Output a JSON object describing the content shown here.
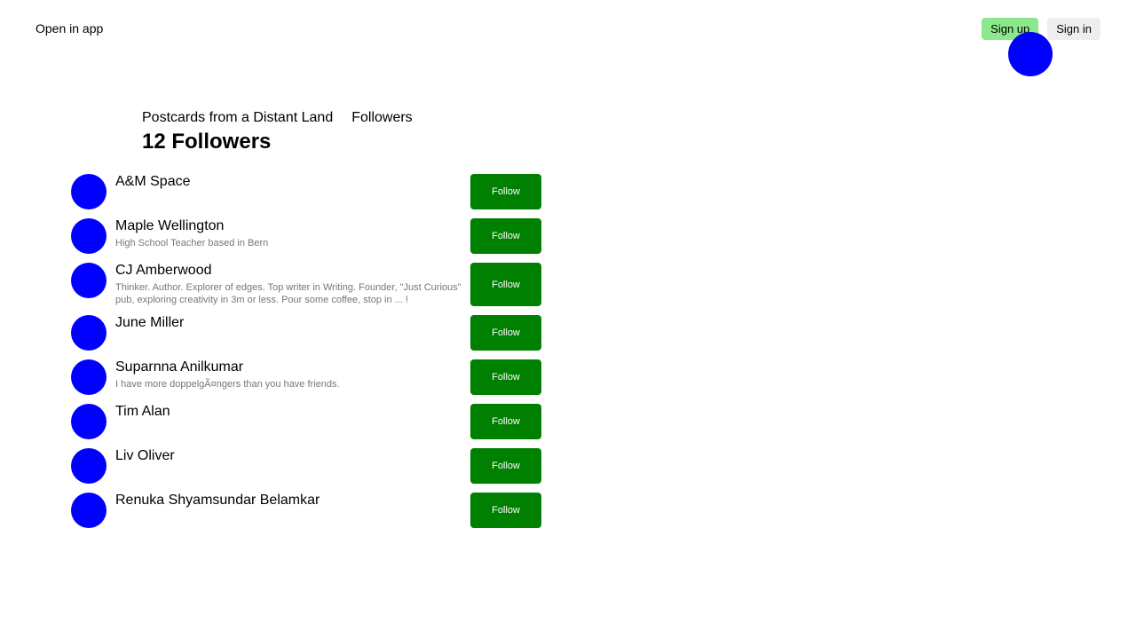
{
  "header": {
    "open_in_app": "Open in app",
    "signup_label": "Sign up",
    "signin_label": "Sign in"
  },
  "breadcrumb": {
    "publication": "Postcards from a Distant Land",
    "section": "Followers"
  },
  "page_title": "12 Followers",
  "followers": [
    {
      "name": "A&M Space",
      "bio": "",
      "follow_label": "Follow"
    },
    {
      "name": "Maple Wellington",
      "bio": "High School Teacher based in Bern",
      "follow_label": "Follow"
    },
    {
      "name": "CJ Amberwood",
      "bio": "Thinker. Author. Explorer of edges. Top writer in Writing. Founder, \"Just Curious\" pub, exploring creativity in 3m or less. Pour some coffee, stop in ... !",
      "follow_label": "Follow"
    },
    {
      "name": "June Miller",
      "bio": "",
      "follow_label": "Follow"
    },
    {
      "name": "Suparnna Anilkumar",
      "bio": "I have more doppelgÃ¤ngers than you have friends.",
      "follow_label": "Follow"
    },
    {
      "name": "Tim Alan",
      "bio": "",
      "follow_label": "Follow"
    },
    {
      "name": "Liv Oliver",
      "bio": "",
      "follow_label": "Follow"
    },
    {
      "name": "Renuka Shyamsundar Belamkar",
      "bio": "",
      "follow_label": "Follow"
    }
  ],
  "colors": {
    "avatar": "#0000ff",
    "follow_button": "#008000",
    "signup_button": "#8ce88c",
    "signin_button": "#eeeeee"
  }
}
